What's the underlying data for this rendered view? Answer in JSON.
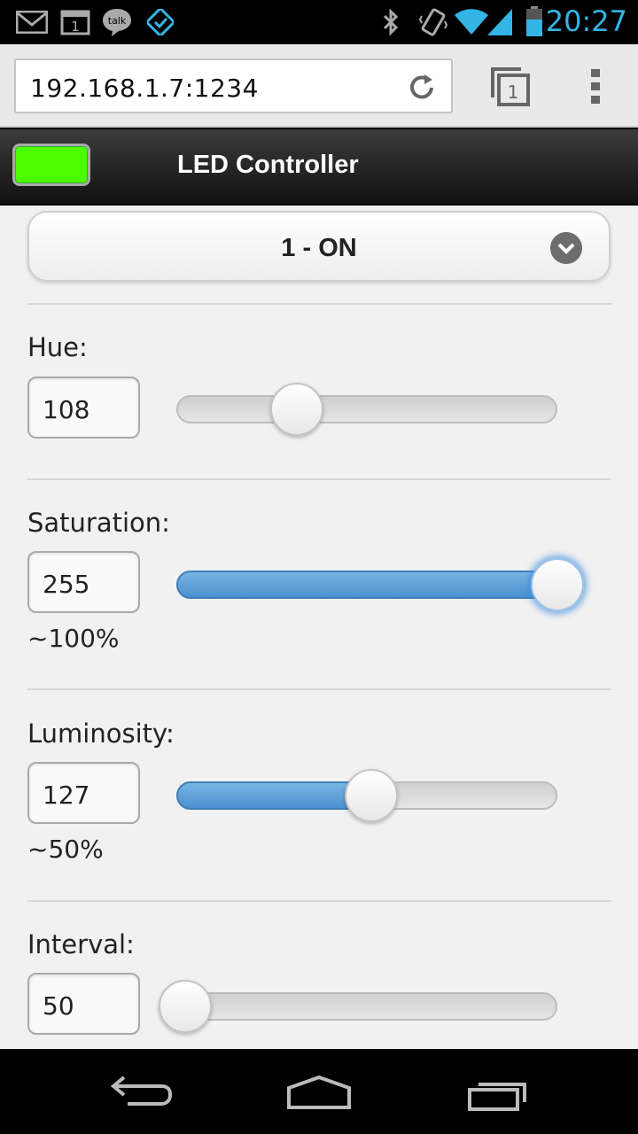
{
  "status_bar": {
    "time": "20:27",
    "icons": [
      "gmail-icon",
      "calendar-icon",
      "talk-icon",
      "swiftkey-icon",
      "bluetooth-icon",
      "vibrate-icon",
      "wifi-icon",
      "signal-icon",
      "battery-icon"
    ],
    "calendar_day": "1",
    "talk_label": "talk"
  },
  "browser": {
    "url": "192.168.1.7:1234",
    "tab_count": "1",
    "icons": [
      "reload-icon",
      "tabs-icon",
      "overflow-menu-icon"
    ]
  },
  "header": {
    "title": "LED Controller",
    "swatch_color": "#4cff00"
  },
  "mode_select": {
    "selected": "1 - ON",
    "icon": "chevron-down-icon"
  },
  "controls": {
    "hue": {
      "label": "Hue:",
      "value": "108",
      "slider_fraction": 0.3
    },
    "saturation": {
      "label": "Saturation:",
      "value": "255",
      "percent_text": "~100%",
      "slider_fraction": 1.0
    },
    "luminosity": {
      "label": "Luminosity:",
      "value": "127",
      "percent_text": "~50%",
      "slider_fraction": 0.5
    },
    "interval": {
      "label": "Interval:",
      "value": "50",
      "slider_fraction": 0.0
    }
  },
  "colors": {
    "accent_blue": "#33b5e5",
    "slider_fill": "#5a9fd9",
    "led_green": "#4cff00"
  },
  "nav_bar": {
    "icons": [
      "back-icon",
      "home-icon",
      "recent-apps-icon"
    ]
  }
}
